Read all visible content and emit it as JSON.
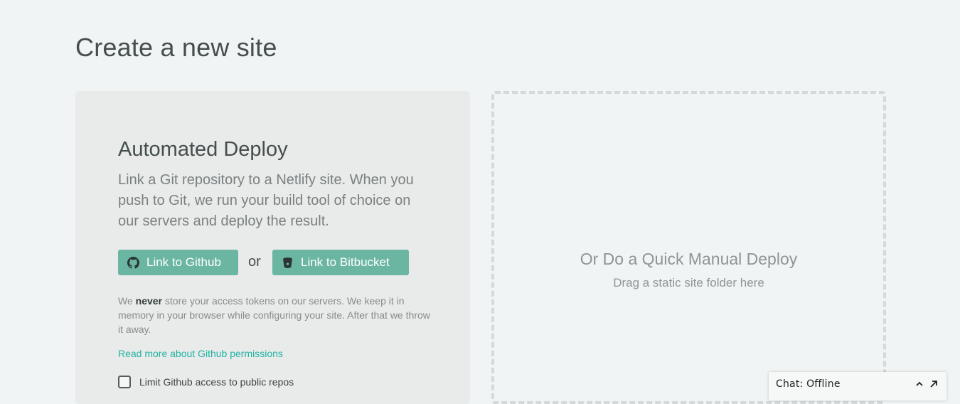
{
  "page": {
    "title": "Create a new site"
  },
  "automated": {
    "title": "Automated Deploy",
    "description": "Link a Git repository to a Netlify site. When you push to Git, we run your build tool of choice on our servers and deploy the result.",
    "github_button": "Link to Github",
    "or_text": "or",
    "bitbucket_button": "Link to Bitbucket",
    "note_prefix": "We ",
    "note_bold": "never",
    "note_suffix": " store your access tokens on our servers. We keep it in memory in your browser while configuring your site. After that we throw it away.",
    "permissions_link": "Read more about Github permissions",
    "limit_label": "Limit Github access to public repos",
    "limit_checked": false
  },
  "manual": {
    "title": "Or Do a Quick Manual Deploy",
    "subtitle": "Drag a static site folder here"
  },
  "chat": {
    "label": "Chat: Offline"
  },
  "colors": {
    "background": "#f1f4f4",
    "button": "#6bb5a3",
    "link": "#21b3a2"
  },
  "icons": {
    "github_button": "github-icon",
    "bitbucket_button": "bitbucket-icon",
    "chat_expand": "chevron-up-icon",
    "chat_popout": "popout-arrow-icon"
  }
}
